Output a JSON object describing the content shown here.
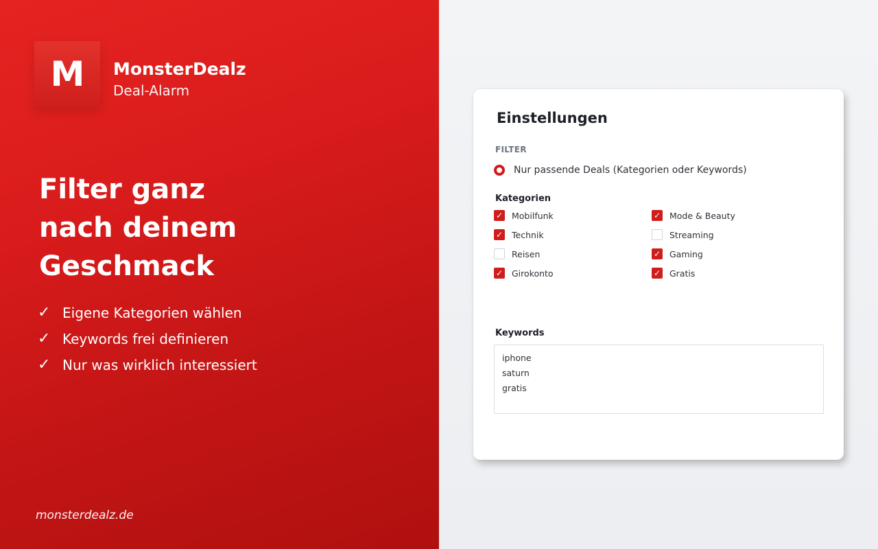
{
  "brand": {
    "logo_letter": "M",
    "name": "MonsterDealz",
    "subtitle": "Deal-Alarm",
    "accent_color": "#d11a1a"
  },
  "hero": {
    "headline_lines": [
      "Filter ganz",
      "nach deinem",
      "Geschmack"
    ],
    "features": [
      "Eigene Kategorien wählen",
      "Keywords frei definieren",
      "Nur was wirklich interessiert"
    ],
    "check_icon": "✓",
    "footer_link": "monsterdealz.de"
  },
  "settings": {
    "title": "Einstellungen",
    "filter_label": "FILTER",
    "filter_option": {
      "label": "Nur passende Deals (Kategorien oder Keywords)",
      "selected": true
    },
    "categories_label": "Kategorien",
    "categories": [
      {
        "label": "Mobilfunk",
        "checked": true
      },
      {
        "label": "Technik",
        "checked": true
      },
      {
        "label": "Reisen",
        "checked": false
      },
      {
        "label": "Girokonto",
        "checked": true
      },
      {
        "label": "Mode & Beauty",
        "checked": true
      },
      {
        "label": "Streaming",
        "checked": false
      },
      {
        "label": "Gaming",
        "checked": true
      },
      {
        "label": "Gratis",
        "checked": true
      }
    ],
    "keywords_label": "Keywords",
    "keywords": [
      "iphone",
      "saturn",
      "gratis"
    ]
  }
}
